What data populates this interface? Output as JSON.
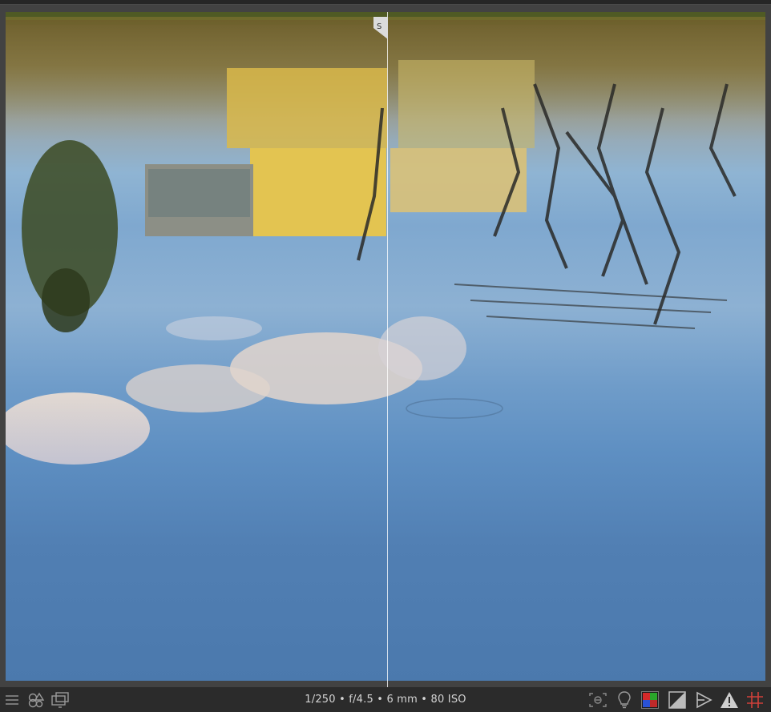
{
  "viewer": {
    "split_handle_label": "S",
    "photo_description_hidden": true
  },
  "statusbar": {
    "exif": "1/250 • f/4.5 • 6 mm • 80 ISO",
    "left_icons": [
      "menu-icon",
      "color-channels-icon",
      "monitor-icon"
    ],
    "right_icons": [
      "focus-peaking-icon",
      "lightbulb-icon",
      "color-picker-icon",
      "clipping-icon",
      "softproof-icon",
      "warning-icon",
      "grid-icon"
    ]
  },
  "colors": {
    "background": "#3a3a3a",
    "statusbar": "#2b2b2b",
    "water_blue": "#5e8fc2",
    "house_yellow": "#e2c24a",
    "reeds": "#8a7b49"
  }
}
